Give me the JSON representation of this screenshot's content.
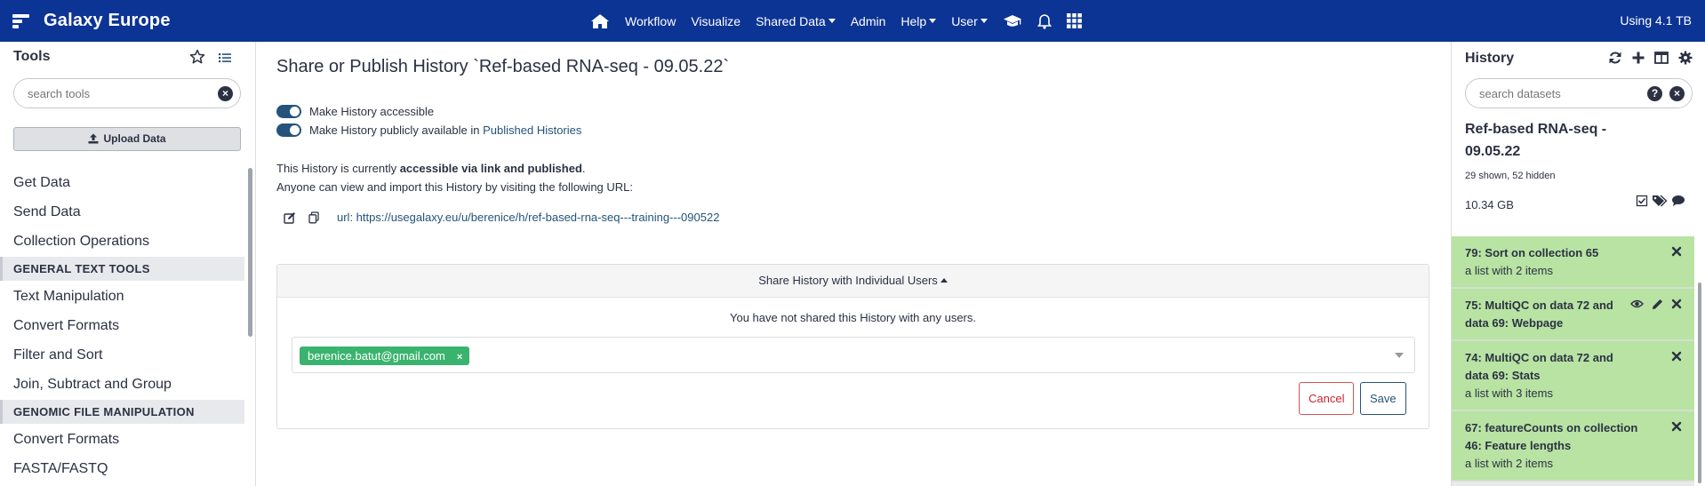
{
  "masthead": {
    "brand": "Galaxy Europe",
    "nav": [
      {
        "label": "Workflow",
        "dropdown": false
      },
      {
        "label": "Visualize",
        "dropdown": false
      },
      {
        "label": "Shared Data",
        "dropdown": true
      },
      {
        "label": "Admin",
        "dropdown": false
      },
      {
        "label": "Help",
        "dropdown": true
      },
      {
        "label": "User",
        "dropdown": true
      }
    ],
    "icons": [
      "home-icon",
      "graduation-cap-icon",
      "bell-icon",
      "grid-icon"
    ],
    "usage": "Using 4.1 TB",
    "bg_color": "#0c3494"
  },
  "tool_panel": {
    "title": "Tools",
    "search_placeholder": "search tools",
    "upload_label": "Upload Data",
    "items": [
      {
        "type": "tool",
        "label": "Get Data"
      },
      {
        "type": "tool",
        "label": "Send Data"
      },
      {
        "type": "tool",
        "label": "Collection Operations"
      },
      {
        "type": "section",
        "label": "GENERAL TEXT TOOLS"
      },
      {
        "type": "tool",
        "label": "Text Manipulation"
      },
      {
        "type": "tool",
        "label": "Convert Formats"
      },
      {
        "type": "tool",
        "label": "Filter and Sort"
      },
      {
        "type": "tool",
        "label": "Join, Subtract and Group"
      },
      {
        "type": "section",
        "label": "GENOMIC FILE MANIPULATION"
      },
      {
        "type": "tool",
        "label": "Convert Formats"
      },
      {
        "type": "tool",
        "label": "FASTA/FASTQ"
      }
    ]
  },
  "center": {
    "title": "Share or Publish History `Ref-based RNA-seq - 09.05.22`",
    "toggle_accessible": "Make History accessible",
    "toggle_public": "Make History publicly available in",
    "published_link": "Published Histories",
    "status_prefix": "This History is currently",
    "status_bold": "accessible via link and published",
    "status_suffix": ".",
    "anyone_text": "Anyone can view and import this History by visiting the following URL:",
    "url": "url: https://usegalaxy.eu/u/berenice/h/ref-based-rna-seq---training---090522",
    "share_header": "Share History with Individual Users",
    "not_shared": "You have not shared this History with any users.",
    "user_tag": "berenice.batut@gmail.com",
    "tag_remove": "×",
    "cancel_label": "Cancel",
    "save_label": "Save"
  },
  "history": {
    "title": "History",
    "search_placeholder": "search datasets",
    "name": "Ref-based RNA-seq - 09.05.22",
    "counts": "29 shown, 52 hidden",
    "size": "10.34 GB",
    "datasets": [
      {
        "title": "79: Sort on collection 65",
        "subtitle": "a list with 2 items",
        "icons": [
          "close-icon"
        ]
      },
      {
        "title": "75: MultiQC on data 72 and data 69: Webpage",
        "subtitle": "",
        "icons": [
          "eye-icon",
          "pencil-icon",
          "close-icon"
        ]
      },
      {
        "title": "74: MultiQC on data 72 and data 69: Stats",
        "subtitle": "a list with 3 items",
        "icons": [
          "close-icon"
        ]
      },
      {
        "title": "67: featureCounts on collection 46: Feature lengths",
        "subtitle": "a list with 2 items",
        "icons": [
          "close-icon"
        ]
      }
    ],
    "dataset_color": "#b8e3a3"
  }
}
